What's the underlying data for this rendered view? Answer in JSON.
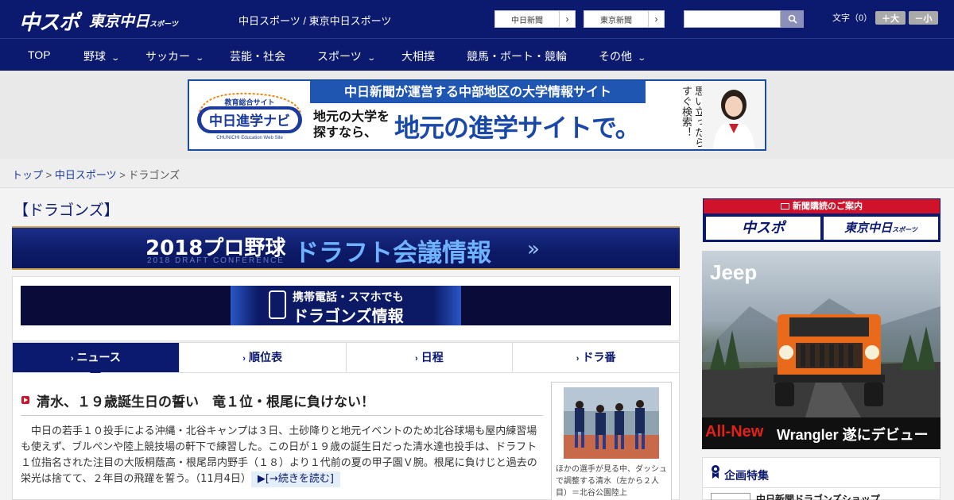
{
  "header": {
    "logo_chuspo": "中スポ",
    "logo_tokyo": "東京中日",
    "logo_tokyo_small": "スポーツ",
    "site_title": "中日スポーツ / 東京中日スポーツ",
    "link_chunichi": "中日新聞",
    "link_tokyo": "東京新聞",
    "arrow": "›",
    "font_size_label": "文字（0）",
    "font_up": "＋大",
    "font_down": "－小"
  },
  "nav": [
    {
      "label": "TOP"
    },
    {
      "label": "野球"
    },
    {
      "label": "サッカー"
    },
    {
      "label": "芸能・社会"
    },
    {
      "label": "スポーツ"
    },
    {
      "label": "大相撲"
    },
    {
      "label": "競馬・ボート・競輪"
    },
    {
      "label": "その他"
    }
  ],
  "nav_chevron": "⌄",
  "top_ad": {
    "logo_caption": "教育総合サイト",
    "logo_name": "中日進学ナビ",
    "logo_sub": "CHUNICHI Education Web Site",
    "headline": "中日新聞が運営する中部地区の大学情報サイト",
    "sub": "地元の大学を\n探すなら、",
    "big": "地元の進学サイトで。",
    "vertical": "スマホでも\n思い立ったら\nすぐ検索！"
  },
  "breadcrumb": {
    "top": "トップ",
    "sep": " > ",
    "chunichi": "中日スポーツ",
    "current": "ドラゴンズ"
  },
  "section_title": "【ドラゴンズ】",
  "draft_banner": {
    "year": "2018プロ野球",
    "main": "ドラフト会議情報",
    "sub": "2018 DRAFT CONFERENCE",
    "arrows": "»"
  },
  "mobile_banner": {
    "line1": "携帯電話・スマホでも",
    "line2": "ドラゴンズ情報"
  },
  "tabs": [
    {
      "label": "ニュース",
      "active": true
    },
    {
      "label": "順位表",
      "active": false
    },
    {
      "label": "日程",
      "active": false
    },
    {
      "label": "ドラ番",
      "active": false
    }
  ],
  "tab_arrow": "›",
  "article": {
    "title": "清水、１９歳誕生日の誓い　竜１位・根尾に負けない！",
    "body": "中日の若手１０投手による沖縄・北谷キャンプは３日、土砂降りと地元イベントのため北谷球場も屋内練習場も使えず、ブルペンや陸上競技場の軒下で練習した。この日が１９歳の誕生日だった清水達也投手は、ドラフト１位指名された注目の大阪桐蔭高・根尾昂内野手（１８）より１代前の夏の甲子園Ｖ腕。根尾に負けじと過去の栄光は捨てて、２年目の飛躍を誓う。",
    "date": "（11月4日）",
    "more": "▶[→続きを読む]",
    "photo_caption": "ほかの選手が見る中、ダッシュで調整する清水（左から２人目）＝北谷公園陸上"
  },
  "subscription": {
    "head": "新聞購読のご案内",
    "btn1": "中スポ",
    "btn2": "東京中日",
    "btn2_small": "スポーツ"
  },
  "jeep_ad": {
    "brand": "Jeep",
    "tagline_red": "All-New",
    "tagline_white": "Wrangler 遂にデビュー"
  },
  "feature": {
    "title": "企画特集",
    "item": "中日新聞ドラゴンズショップ"
  },
  "colors": {
    "navy": "#0b1a6e",
    "red": "#d0122a",
    "ad_blue": "#1f56b2"
  }
}
